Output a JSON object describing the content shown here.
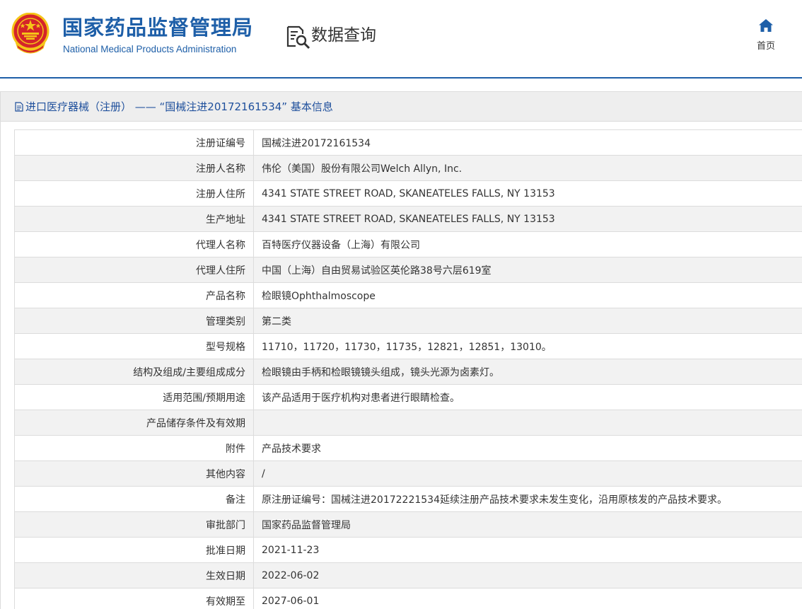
{
  "header": {
    "title_cn": "国家药品监督管理局",
    "title_en": "National Medical Products Administration",
    "query_title": "数据查询",
    "home_label": "首页"
  },
  "panel": {
    "heading": "进口医疗器械（注册） —— “国械注进20172161534” 基本信息"
  },
  "rows": [
    {
      "label": "注册证编号",
      "value": "国械注进20172161534"
    },
    {
      "label": "注册人名称",
      "value": "伟伦（美国）股份有限公司Welch Allyn, Inc."
    },
    {
      "label": "注册人住所",
      "value": "4341 STATE STREET ROAD, SKANEATELES FALLS, NY 13153"
    },
    {
      "label": "生产地址",
      "value": "4341 STATE STREET ROAD, SKANEATELES FALLS, NY 13153"
    },
    {
      "label": "代理人名称",
      "value": "百特医疗仪器设备（上海）有限公司"
    },
    {
      "label": "代理人住所",
      "value": "中国（上海）自由贸易试验区英伦路38号六层619室"
    },
    {
      "label": "产品名称",
      "value": "检眼镜Ophthalmoscope"
    },
    {
      "label": "管理类别",
      "value": "第二类"
    },
    {
      "label": "型号规格",
      "value": "11710，11720，11730，11735，12821，12851，13010。"
    },
    {
      "label": "结构及组成/主要组成成分",
      "value": "检眼镜由手柄和检眼镜镜头组成，镜头光源为卤素灯。"
    },
    {
      "label": "适用范围/预期用途",
      "value": "该产品适用于医疗机构对患者进行眼睛检查。"
    },
    {
      "label": "产品储存条件及有效期",
      "value": ""
    },
    {
      "label": "附件",
      "value": "产品技术要求"
    },
    {
      "label": "其他内容",
      "value": "/"
    },
    {
      "label": "备注",
      "value": "原注册证编号：国械注进20172221534延续注册产品技术要求未发生变化，沿用原核发的产品技术要求。"
    },
    {
      "label": "审批部门",
      "value": "国家药品监督管理局"
    },
    {
      "label": "批准日期",
      "value": "2021-11-23"
    },
    {
      "label": "生效日期",
      "value": "2022-06-02"
    },
    {
      "label": "有效期至",
      "value": "2027-06-01"
    }
  ],
  "colors": {
    "brand_blue": "#1e5fa8",
    "emblem_red": "#d4242a",
    "emblem_gold": "#f5c518",
    "row_alt": "#f2f2f2",
    "border": "#dcdcdc"
  }
}
